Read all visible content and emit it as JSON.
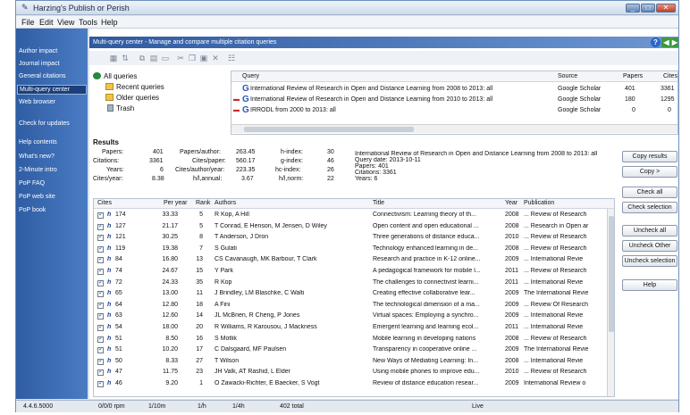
{
  "window": {
    "title": "Harzing's Publish or Perish",
    "min": "_",
    "max": "□",
    "close": "✕"
  },
  "menu": [
    "File",
    "Edit",
    "View",
    "Tools",
    "Help"
  ],
  "sidebar": {
    "items": [
      {
        "label": "Author impact"
      },
      {
        "label": "Journal impact"
      },
      {
        "label": "General citations"
      },
      {
        "label": "Multi-query center",
        "selected": true
      },
      {
        "label": "Web browser"
      },
      {
        "label": "Check for updates"
      },
      {
        "label": "Help contents"
      },
      {
        "label": "What's new?"
      },
      {
        "label": "2-Minute intro"
      },
      {
        "label": "PoP FAQ"
      },
      {
        "label": "PoP web site"
      },
      {
        "label": "PoP book"
      }
    ]
  },
  "header": {
    "title": "Multi-query center - Manage and compare multiple citation queries",
    "help": "?",
    "back": "◀",
    "forward": "▶"
  },
  "tree": {
    "all": "All queries",
    "recent": "Recent queries",
    "older": "Older queries",
    "trash": "Trash"
  },
  "queries": {
    "columns": {
      "query": "Query",
      "source": "Source",
      "papers": "Papers",
      "cites": "Cites"
    },
    "rows": [
      {
        "mark": "",
        "query": "International Review of Research in Open and Distance Learning from 2008 to 2013: all",
        "source": "Google Scholar",
        "papers": "401",
        "cites": "3361"
      },
      {
        "mark": "▬",
        "query": "International Review of Research in Open and Distance Learning from 2010 to 2013: all",
        "source": "Google Scholar",
        "papers": "180",
        "cites": "1295"
      },
      {
        "mark": "▬",
        "query": "IRRODL from 2000 to 2013: all",
        "source": "Google Scholar",
        "papers": "0",
        "cites": "0"
      }
    ]
  },
  "results": {
    "label": "Results",
    "metrics": {
      "papers_l": "Papers:",
      "papers_v": "401",
      "citations_l": "Citations:",
      "citations_v": "3361",
      "years_l": "Years:",
      "years_v": "6",
      "cpy_l": "Cites/year:",
      "cpy_v": "8.38",
      "ppa_l": "Papers/author:",
      "ppa_v": "263.45",
      "cpp_l": "Cites/paper:",
      "cpp_v": "560.17",
      "cpa_l": "Cites/author/year:",
      "cpa_v": "223.35",
      "hla_l": "h/l,annual:",
      "hla_v": "3.67",
      "h_l": "h-index:",
      "h_v": "30",
      "g_l": "g-index:",
      "g_v": "46",
      "hc_l": "hc-index:",
      "hc_v": "26",
      "hlnorm_l": "h/l,norm:",
      "hlnorm_v": "22"
    },
    "summary": [
      "International Review of Research in Open and Distance Learning from 2008 to 2013: all",
      "Query date: 2013-10-11",
      "Papers: 401",
      "Citations: 3361",
      "Years: 6"
    ]
  },
  "actions": {
    "copy_results": "Copy results",
    "copy": "Copy >",
    "check_all": "Check all",
    "check_selection": "Check selection",
    "uncheck_all": "Uncheck all",
    "uncheck_other": "Uncheck Other",
    "uncheck_selection": "Uncheck selection",
    "help": "Help"
  },
  "grid": {
    "columns": {
      "cites": "Cites",
      "per_year": "Per year",
      "rank": "Rank",
      "authors": "Authors",
      "title": "Title",
      "year": "Year",
      "publication": "Publication"
    },
    "rows": [
      {
        "cites": "174",
        "per_year": "33.33",
        "rank": "5",
        "authors": "R Kop, A Hill",
        "title": "Connectivism: Learning theory of th...",
        "year": "2008",
        "publication": "... Review of Research"
      },
      {
        "cites": "127",
        "per_year": "21.17",
        "rank": "5",
        "authors": "T Conrad, E Henson, M Jensen, D Wiley",
        "title": "Open content and open educational ...",
        "year": "2008",
        "publication": "... Research in Open ar"
      },
      {
        "cites": "121",
        "per_year": "30.25",
        "rank": "8",
        "authors": "T Anderson, J Dron",
        "title": "Three generations of distance educa...",
        "year": "2010",
        "publication": "... Review of Research"
      },
      {
        "cites": "119",
        "per_year": "19.38",
        "rank": "7",
        "authors": "S Gulati",
        "title": "Technology enhanced learning in de...",
        "year": "2008",
        "publication": "... Review of Research"
      },
      {
        "cites": "84",
        "per_year": "16.80",
        "rank": "13",
        "authors": "CS Cavanaugh, MK Barbour, T Clark",
        "title": "Research and practice in K-12 online...",
        "year": "2009",
        "publication": "... International Revie"
      },
      {
        "cites": "74",
        "per_year": "24.67",
        "rank": "15",
        "authors": "Y Park",
        "title": "A pedagogical framework for mobile l...",
        "year": "2011",
        "publication": "... Review of Research"
      },
      {
        "cites": "72",
        "per_year": "24.33",
        "rank": "35",
        "authors": "R Kop",
        "title": "The challenges to connectivist learni...",
        "year": "2011",
        "publication": "... International Revie"
      },
      {
        "cites": "65",
        "per_year": "13.00",
        "rank": "11",
        "authors": "J Brindley, LM Blaschke, C Walti",
        "title": "Creating effective collaborative lear...",
        "year": "2009",
        "publication": "The International Revie"
      },
      {
        "cites": "64",
        "per_year": "12.80",
        "rank": "18",
        "authors": "A Fini",
        "title": "The technological dimension of a ma...",
        "year": "2009",
        "publication": "... Review Of Research"
      },
      {
        "cites": "63",
        "per_year": "12.60",
        "rank": "14",
        "authors": "JL McBrien, R Cheng, P Jones",
        "title": "Virtual spaces: Employing a synchro...",
        "year": "2009",
        "publication": "... International Revie"
      },
      {
        "cites": "54",
        "per_year": "18.00",
        "rank": "20",
        "authors": "R Williams, R Karousou, J Mackness",
        "title": "Emergent learning and learning ecol...",
        "year": "2011",
        "publication": "... International Revie"
      },
      {
        "cites": "51",
        "per_year": "8.50",
        "rank": "16",
        "authors": "S Motlik",
        "title": "Mobile learning in developing nations",
        "year": "2008",
        "publication": "... Review of Research"
      },
      {
        "cites": "51",
        "per_year": "10.20",
        "rank": "17",
        "authors": "C Dalsgaard, MF Paulsen",
        "title": "Transparency in cooperative online ...",
        "year": "2009",
        "publication": "The International Revie"
      },
      {
        "cites": "50",
        "per_year": "8.33",
        "rank": "27",
        "authors": "T Wilson",
        "title": "New Ways of Mediating Learning: In...",
        "year": "2008",
        "publication": "... International Revie"
      },
      {
        "cites": "47",
        "per_year": "11.75",
        "rank": "23",
        "authors": "JH Valk, AT Rashid, L Elder",
        "title": "Using mobile phones to improve edu...",
        "year": "2010",
        "publication": "... Review of Research"
      },
      {
        "cites": "46",
        "per_year": "9.20",
        "rank": "1",
        "authors": "O Zawacki-Richter, E Baecker, S Vogt",
        "title": "Review of distance education resear...",
        "year": "2009",
        "publication": "International Review o"
      }
    ]
  },
  "status": {
    "version": "4.4.6.5000",
    "rate": "0/0/0 rpm",
    "per10m": "1/10m",
    "perh": "1/h",
    "per4h": "1/4h",
    "total": "402 total",
    "mode": "Live"
  }
}
